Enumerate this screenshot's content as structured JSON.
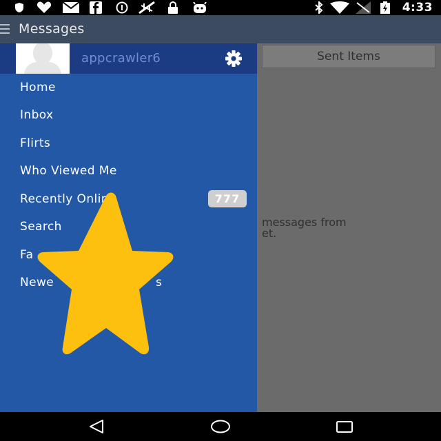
{
  "status_bar": {
    "time": "4:33",
    "icons": [
      "shield-icon",
      "heart-icon",
      "mail-icon",
      "facebook-icon",
      "circle-icon",
      "no-signal-icon",
      "lock-icon",
      "android-icon",
      "bluetooth-icon",
      "wifi-icon",
      "signal-icon",
      "battery-icon"
    ]
  },
  "app_bar": {
    "title": "Messages"
  },
  "background": {
    "tab_sent": "Sent Items",
    "empty_line1": "messages from",
    "empty_line2": "et."
  },
  "drawer": {
    "username": "appcrawler6",
    "menu": [
      {
        "label": "Home"
      },
      {
        "label": "Inbox"
      },
      {
        "label": "Flirts"
      },
      {
        "label": "Who Viewed Me"
      },
      {
        "label": "Recently Online",
        "badge": "777"
      },
      {
        "label": "Search"
      },
      {
        "label": "Fa"
      },
      {
        "label": "Newe",
        "suffix": "s"
      }
    ]
  },
  "nav_bar": {
    "buttons": [
      "back-icon",
      "home-icon",
      "recents-icon"
    ]
  },
  "colors": {
    "drawer_bg": "#2258a6",
    "drawer_header_bg": "#1b3c82",
    "app_bar_bg": "#3c4b5f",
    "star": "#fdc00f"
  }
}
